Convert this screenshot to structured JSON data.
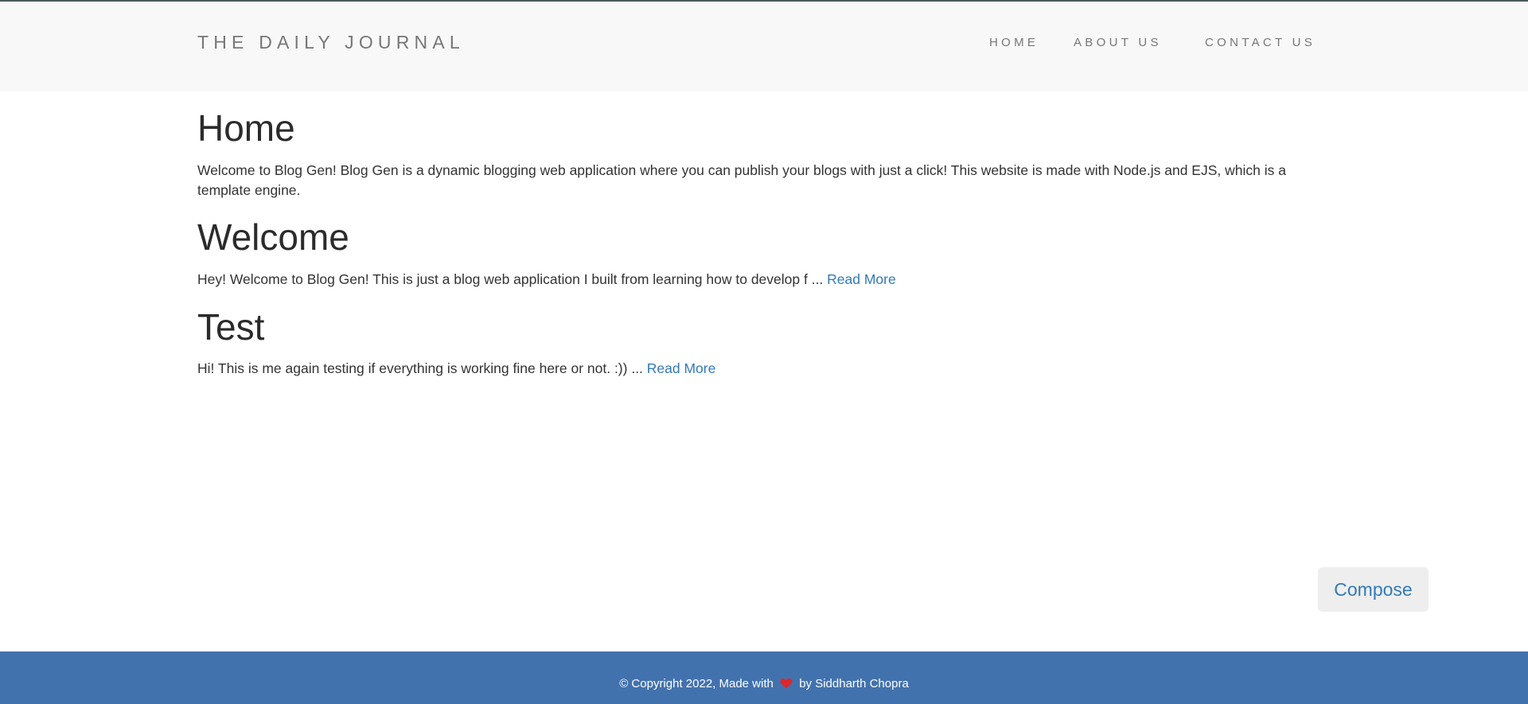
{
  "header": {
    "brand": "THE DAILY JOURNAL",
    "nav": [
      {
        "label": "HOME"
      },
      {
        "label": "ABOUT US"
      },
      {
        "label": "CONTACT US"
      }
    ]
  },
  "main": {
    "title": "Home",
    "intro": "Welcome to Blog Gen! Blog Gen is a dynamic blogging web application where you can publish your blogs with just a click! This website is made with Node.js and EJS, which is a template engine.",
    "posts": [
      {
        "title": "Welcome",
        "excerpt": "Hey! Welcome to Blog Gen! This is just a blog web application I built from learning how to develop f ... ",
        "read_more": "Read More"
      },
      {
        "title": "Test",
        "excerpt": "Hi! This is me again testing if everything is working fine here or not. :)) ... ",
        "read_more": "Read More"
      }
    ],
    "compose_label": "Compose"
  },
  "footer": {
    "text_before": "© Copyright 2022, Made with ",
    "heart_icon": "heart-icon",
    "text_after": " by Siddharth Chopra"
  },
  "colors": {
    "navbar_bg": "#f8f8f8",
    "footer_bg": "#4272ae",
    "link": "#337ab7",
    "heart": "#e0262a"
  }
}
